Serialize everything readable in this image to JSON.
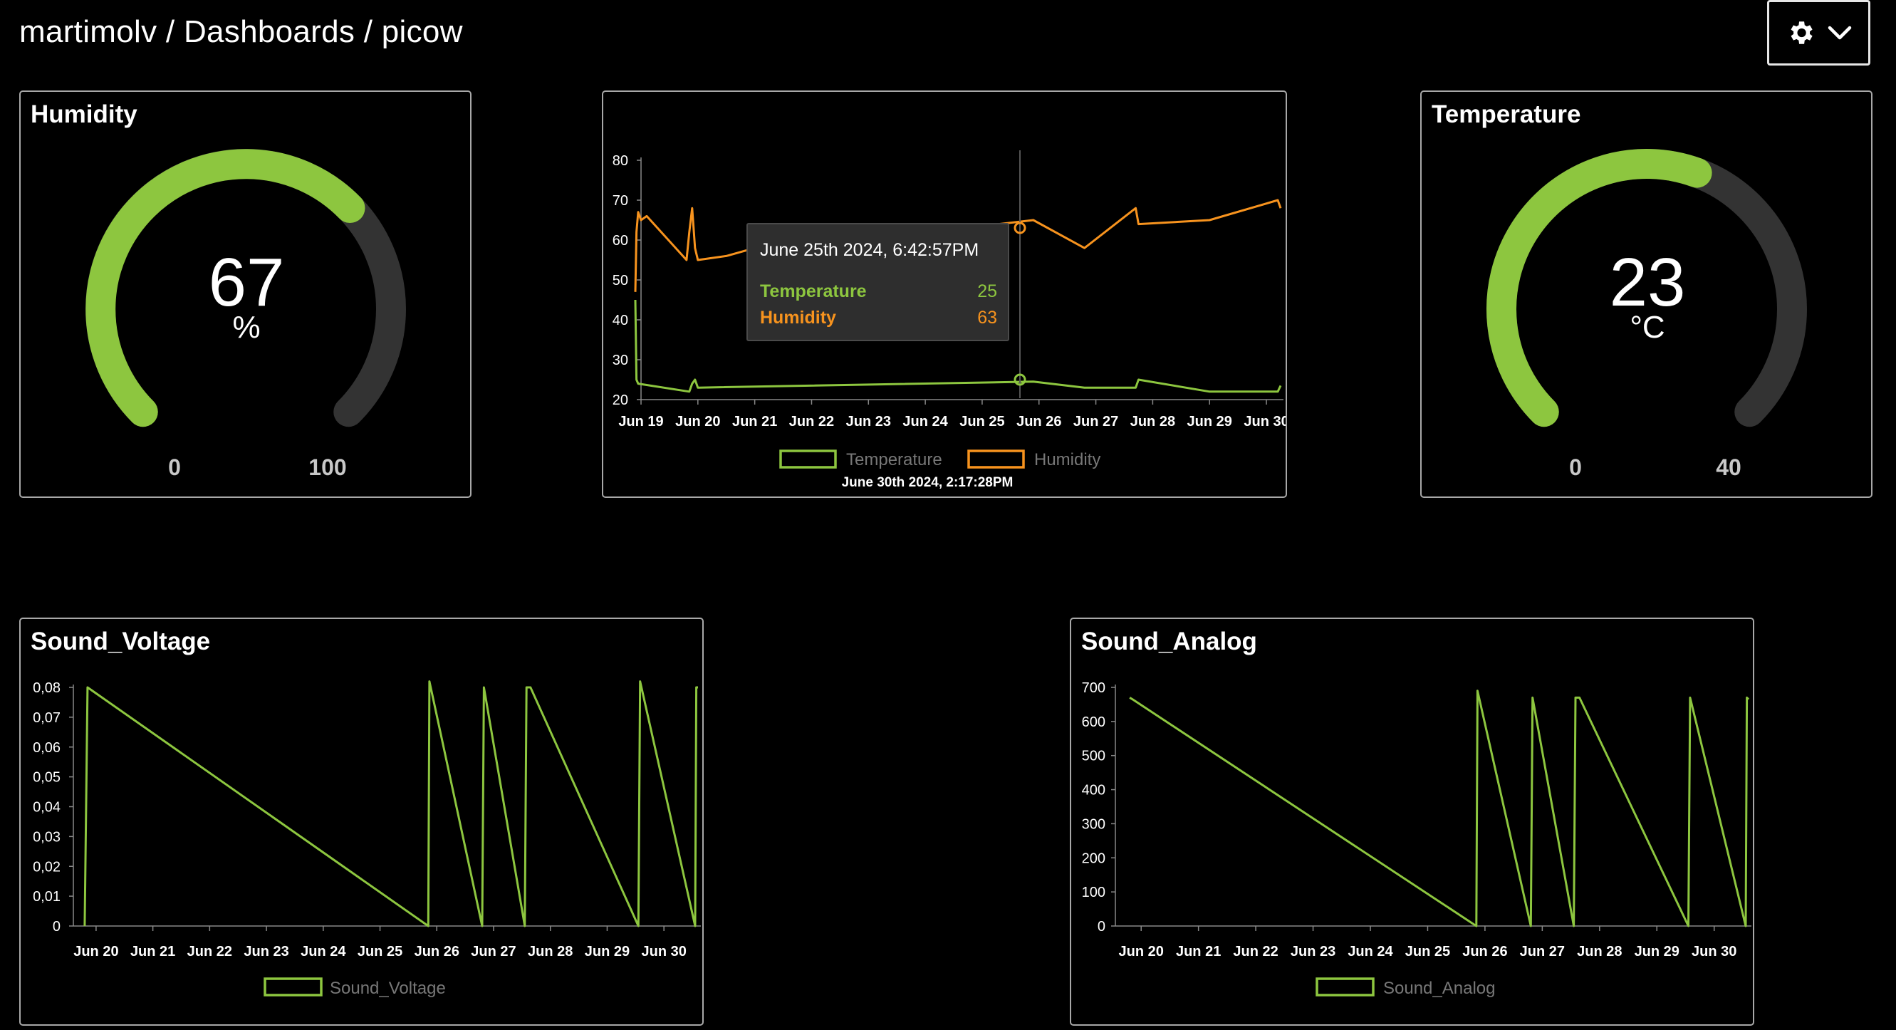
{
  "breadcrumb": "martimolv / Dashboards / picow",
  "settings": {
    "icons": [
      "gear-icon",
      "chevron-down-icon"
    ]
  },
  "humidity": {
    "title": "Humidity",
    "value": "67",
    "unit": "%",
    "min": "0",
    "max": "100",
    "fraction": 0.67,
    "color": "#8dc63f"
  },
  "temperature": {
    "title": "Temperature",
    "value": "23",
    "unit": "°C",
    "min": "0",
    "max": "40",
    "fraction": 0.575,
    "color": "#8dc63f"
  },
  "colors": {
    "green": "#8dc63f",
    "orange": "#f7931e",
    "track": "#333333"
  },
  "main_chart": {
    "legend": [
      "Temperature",
      "Humidity"
    ],
    "footer": "June 30th 2024, 2:17:28PM",
    "tooltip": {
      "title": "June 25th 2024, 6:42:57PM",
      "rows": [
        {
          "label": "Temperature",
          "value": "25"
        },
        {
          "label": "Humidity",
          "value": "63"
        }
      ]
    }
  },
  "sound_voltage": {
    "title": "Sound_Voltage",
    "legend": "Sound_Voltage"
  },
  "sound_analog": {
    "title": "Sound_Analog",
    "legend": "Sound_Analog"
  },
  "chart_data": [
    {
      "type": "line",
      "x_ticks": [
        "Jun 19",
        "Jun 20",
        "Jun 21",
        "Jun 22",
        "Jun 23",
        "Jun 24",
        "Jun 25",
        "Jun 26",
        "Jun 27",
        "Jun 28",
        "Jun 29",
        "Jun 30"
      ],
      "y_ticks": [
        "80",
        "70",
        "60",
        "50",
        "40",
        "30",
        "20"
      ],
      "ylim": [
        20,
        80
      ],
      "series": [
        {
          "name": "Temperature",
          "x": [
            18.9,
            18.92,
            18.95,
            19.85,
            19.9,
            19.95,
            20.0,
            25.9,
            26.8,
            27.7,
            27.75,
            29.0,
            30.2,
            30.25
          ],
          "y": [
            45,
            25,
            24,
            22,
            24,
            25,
            23,
            24.5,
            23,
            23,
            25,
            22,
            22,
            23.5
          ]
        },
        {
          "name": "Humidity",
          "x": [
            18.9,
            18.92,
            18.95,
            19.0,
            19.1,
            19.8,
            19.85,
            19.9,
            19.95,
            20.0,
            20.5,
            21.0,
            21.7,
            25.9,
            26.8,
            27.7,
            27.75,
            29.0,
            30.2,
            30.25
          ],
          "y": [
            47,
            62,
            67,
            65,
            66,
            55,
            62,
            68,
            58,
            55,
            56,
            58,
            58,
            65,
            58,
            68,
            64,
            65,
            70,
            68
          ]
        }
      ]
    },
    {
      "type": "line",
      "x_ticks": [
        "Jun 20",
        "Jun 21",
        "Jun 22",
        "Jun 23",
        "Jun 24",
        "Jun 25",
        "Jun 26",
        "Jun 27",
        "Jun 28",
        "Jun 29",
        "Jun 30"
      ],
      "y_ticks": [
        "0,08",
        "0,07",
        "0,06",
        "0,05",
        "0,04",
        "0,03",
        "0,02",
        "0,01",
        "0"
      ],
      "ylim": [
        0,
        0.08
      ],
      "series": [
        {
          "name": "Sound_Voltage",
          "x": [
            19.8,
            19.85,
            25.85,
            25.87,
            26.8,
            26.83,
            27.55,
            27.58,
            27.65,
            29.55,
            29.58,
            30.55,
            30.57,
            30.6
          ],
          "y": [
            0,
            0.08,
            0,
            0.082,
            0,
            0.08,
            0,
            0.08,
            0.08,
            0,
            0.082,
            0,
            0.08,
            0.08
          ]
        }
      ]
    },
    {
      "type": "line",
      "x_ticks": [
        "Jun 20",
        "Jun 21",
        "Jun 22",
        "Jun 23",
        "Jun 24",
        "Jun 25",
        "Jun 26",
        "Jun 27",
        "Jun 28",
        "Jun 29",
        "Jun 30"
      ],
      "y_ticks": [
        "700",
        "600",
        "500",
        "400",
        "300",
        "200",
        "100",
        "0"
      ],
      "ylim": [
        0,
        700
      ],
      "series": [
        {
          "name": "Sound_Analog",
          "x": [
            19.8,
            19.85,
            25.85,
            25.87,
            26.8,
            26.83,
            27.55,
            27.58,
            27.65,
            29.55,
            29.58,
            30.55,
            30.57,
            30.6
          ],
          "y": [
            670,
            665,
            0,
            690,
            0,
            670,
            0,
            670,
            670,
            0,
            670,
            0,
            670,
            665
          ]
        }
      ]
    }
  ]
}
